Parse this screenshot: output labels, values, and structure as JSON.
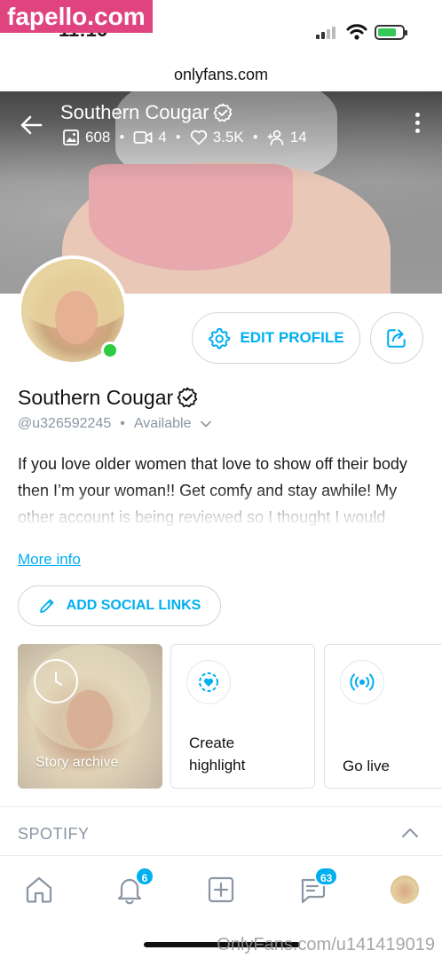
{
  "watermarks": {
    "top_left": "fapello.com",
    "bottom_right": "OnlyFans.com/u141419019"
  },
  "status_bar": {
    "time": "11:16"
  },
  "browser": {
    "url": "onlyfans.com"
  },
  "cover": {
    "name": "Southern Cougar",
    "stats": {
      "photos": "608",
      "videos": "4",
      "likes": "3.5K",
      "fans": "14"
    },
    "separator": "•"
  },
  "actions": {
    "edit_profile": "EDIT PROFILE"
  },
  "profile": {
    "name": "Southern Cougar",
    "handle": "@u326592245",
    "separator": "•",
    "status": "Available",
    "bio": "If you love older women that love to show off their body then I’m your woman!! Get comfy and stay awhile! My other account is being reviewed so I thought I would make another one! 😉",
    "more_info": "More info",
    "add_social_links": "ADD SOCIAL LINKS"
  },
  "highlights": {
    "story_archive": "Story archive",
    "create_line1": "Create",
    "create_line2": "highlight",
    "go_live": "Go live"
  },
  "spotify": {
    "title": "SPOTIFY"
  },
  "bottom_nav": {
    "notifications_badge": "6",
    "messages_badge": "63"
  },
  "colors": {
    "accent": "#00aff0",
    "online": "#2ecc40",
    "muted": "#8a96a3",
    "watermark": "#e0447f"
  }
}
